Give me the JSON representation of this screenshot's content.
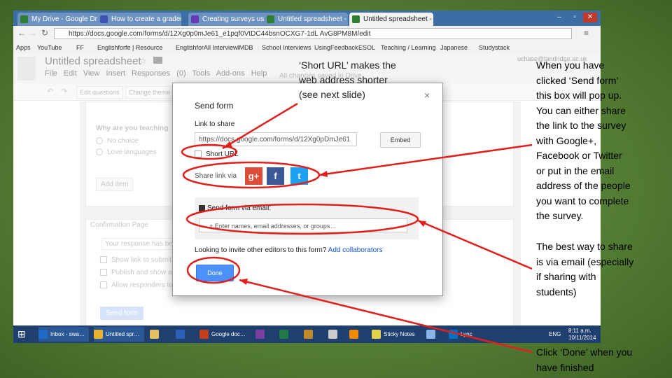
{
  "browser": {
    "tabs": [
      {
        "label": "My Drive - Google Drive",
        "color": "#2e7d32"
      },
      {
        "label": "How to create a graded",
        "color": "#3f51b5"
      },
      {
        "label": "Creating surveys using Goo",
        "color": "#673ab7"
      },
      {
        "label": "Untitled spreadsheet - Go",
        "color": "#2e7d32"
      },
      {
        "label": "Untitled spreadsheet - Go",
        "color": "#2e7d32"
      }
    ],
    "url": "https://docs.google.com/forms/d/12Xg0p0mJe61_e1pqf0VtDC44bsnOCXG7-1dL AvG8PM8M/edit",
    "bookmarks": [
      "Apps",
      "YouTube",
      "FF",
      "Englishforfe | Resource",
      "EnglishforAll Interview",
      "IMDB",
      "School Interviews",
      "UsingFeedback",
      "ESOL",
      "Teaching / Learning",
      "Japanese",
      "Studystack"
    ]
  },
  "sheet": {
    "title": "Untitled spreadsheet",
    "menu": [
      "File",
      "Edit",
      "View",
      "Insert",
      "Responses (0)",
      "Tools",
      "Add-ons",
      "Help"
    ],
    "status": "All changes saved in Drive",
    "user_email": "uchase@tandridge.ac.uk",
    "toolbar": [
      "Edit questions",
      "Change theme"
    ]
  },
  "form_behind": {
    "question": "Why are you teaching",
    "options": [
      "No choice",
      "Love languages"
    ],
    "add_item": "Add item",
    "confirmation_header": "Confirmation Page",
    "confirmation_text": "Your response has been",
    "checkboxes": [
      "Show link to submit a",
      "Publish and show a p",
      "Allow responders to e"
    ],
    "send_form_btn": "Send form"
  },
  "dialog": {
    "title": "Send form",
    "close": "×",
    "link_label": "Link to share",
    "link_value": "https://docs.google.com/forms/d/12Xg0pDmJe61",
    "embed": "Embed",
    "short_url": "Short URL",
    "share_via": "Share link via",
    "social": [
      "g+",
      "f",
      "t"
    ],
    "email_label": "Send form via email:",
    "email_placeholder": "+ Enter names, email addresses, or groups…",
    "collab_text": "Looking to invite other editors to this form?",
    "collab_link": "Add collaborators",
    "done": "Done"
  },
  "taskbar": {
    "items": [
      "Inbox - swa…",
      "Untitled spr…",
      "",
      "",
      "Google doc…",
      "",
      "",
      "",
      "",
      "Sticky Notes",
      "",
      "",
      "Lync"
    ],
    "lang": "ENG",
    "time": "8:11 a.m.",
    "date": "10/11/2014"
  },
  "annotations": {
    "short_url": [
      "‘Short URL’ makes the",
      "web address shorter",
      "(see next slide)"
    ],
    "send_form": [
      "When you have",
      "clicked ‘Send form’",
      "this box will pop up.",
      "You can either share",
      "the link to the survey",
      "with Google+,",
      "Facebook or Twitter",
      "or put in the email",
      "address of the people",
      "you want to complete",
      "the survey."
    ],
    "email": [
      "The best way to share",
      "is via email (especially",
      "if sharing with",
      "students)"
    ],
    "done": [
      "Click ‘Done’ when you",
      "have finished"
    ],
    "highlight_color": "#e0201c"
  }
}
